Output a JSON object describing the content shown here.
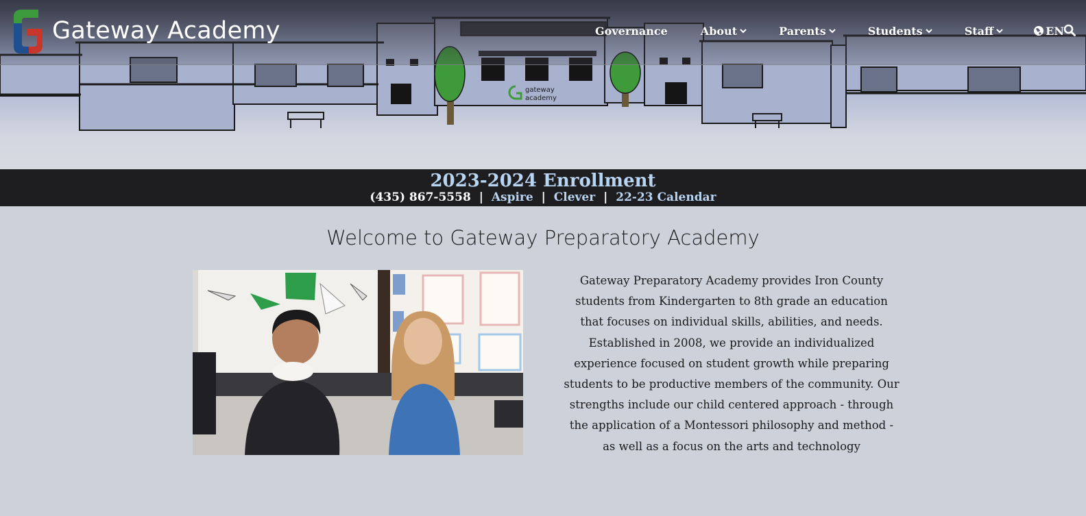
{
  "header": {
    "brand_name": "Gateway Academy",
    "logo_icon": "gateway-g-logo",
    "nav": [
      {
        "label": "Governance",
        "has_dropdown": false
      },
      {
        "label": "About",
        "has_dropdown": true
      },
      {
        "label": "Parents",
        "has_dropdown": true
      },
      {
        "label": "Students",
        "has_dropdown": true
      },
      {
        "label": "Staff",
        "has_dropdown": true
      }
    ],
    "language": "EN",
    "search_icon": "search-icon"
  },
  "hero": {
    "building_sign": [
      "gateway",
      "academy"
    ]
  },
  "enrollment": {
    "title": "2023-2024 Enrollment",
    "phone": "(435) 867-5558",
    "links": [
      "Aspire",
      "Clever",
      "22-23 Calendar"
    ],
    "separator": "|"
  },
  "main": {
    "heading": "Welcome to Gateway Preparatory Academy",
    "description": "Gateway Preparatory Academy provides Iron County students from Kindergarten to 8th grade an education that focuses on individual skills, abilities, and needs. Established in 2008, we provide an individualized experience focused on student growth while preparing students to be productive members of the community. Our strengths include our child centered approach - through the application of a Montessori philosophy and method - as well as a focus on the arts and technology"
  },
  "colors": {
    "page_bg": "#cdd1da",
    "bar_bg": "#1e1e20",
    "link_accent": "#b8d4f1",
    "logo_green": "#3d9a3d",
    "logo_blue": "#1f4f8f",
    "logo_red": "#c8352b"
  }
}
